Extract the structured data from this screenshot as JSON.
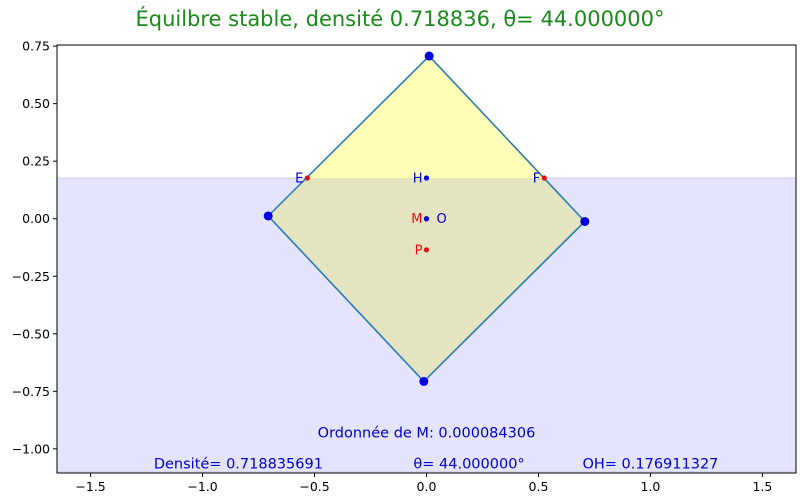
{
  "chart_data": {
    "type": "scatter",
    "title": "Équilbre stable, densité 0.718836, θ= 44.000000°",
    "xlim": [
      -1.65,
      1.65
    ],
    "ylim": [
      -1.105,
      0.755
    ],
    "x_ticks": [
      -1.5,
      -1.0,
      -0.5,
      0.0,
      0.5,
      1.0,
      1.5
    ],
    "y_ticks": [
      -1.0,
      -0.75,
      -0.5,
      -0.25,
      0.0,
      0.25,
      0.5,
      0.75
    ],
    "x_tick_labels": [
      "−1.5",
      "−1.0",
      "−0.5",
      "0.0",
      "0.5",
      "1.0",
      "1.5"
    ],
    "y_tick_labels": [
      "−1.00",
      "−0.75",
      "−0.50",
      "−0.25",
      "0.00",
      "0.25",
      "0.50",
      "0.75"
    ],
    "grid": false,
    "water": {
      "x": [
        -1.65,
        1.65
      ],
      "y_bottom": -1.1,
      "y_top": 0.177,
      "color": "#e4e4fc",
      "edge": "#cfcff5"
    },
    "square": {
      "vertices": [
        [
          0.012,
          0.707
        ],
        [
          0.707,
          -0.012
        ],
        [
          -0.012,
          -0.707
        ],
        [
          -0.707,
          0.012
        ]
      ],
      "edge_color": "#2c7bb6",
      "fill_above_color": "#ffffb8",
      "fill_below_color": "#e4e4c0"
    },
    "vertex_points": {
      "color": "#0000e0"
    },
    "labeled_points": [
      {
        "name": "E",
        "x": -0.532,
        "y": 0.177,
        "color": "#e01010",
        "label_color": "#0000cc",
        "label_side": "left"
      },
      {
        "name": "F",
        "x": 0.526,
        "y": 0.177,
        "color": "#e01010",
        "label_color": "#0000cc",
        "label_side": "left"
      },
      {
        "name": "H",
        "x": 0.0,
        "y": 0.177,
        "color": "#0000e0",
        "label_color": "#0000cc",
        "label_side": "left"
      },
      {
        "name": "M",
        "x": 0.0,
        "y": 0.0,
        "color": "#e01010",
        "label_color": "#e01010",
        "label_side": "left"
      },
      {
        "name": "O",
        "x": 0.0,
        "y": 0.0,
        "color": "#0000e0",
        "label_color": "#0000cc",
        "label_side": "right"
      },
      {
        "name": "P",
        "x": 0.0,
        "y": -0.135,
        "color": "#e01010",
        "label_color": "#e01010",
        "label_side": "left"
      }
    ],
    "annotations": [
      {
        "text": "Ordonnée de M:  0.000084306",
        "x": 0.0,
        "y": -0.93,
        "anchor": "middle"
      },
      {
        "text": "Densité= 0.718835691",
        "x": -0.84,
        "y": -1.063,
        "anchor": "middle"
      },
      {
        "text": "θ= 44.000000°",
        "x": 0.19,
        "y": -1.063,
        "anchor": "middle"
      },
      {
        "text": "OH= 0.176911327",
        "x": 1.0,
        "y": -1.063,
        "anchor": "middle"
      }
    ],
    "colors": {
      "title": "#1a8a1a",
      "annotation": "#0000cc",
      "axes": "#000000"
    }
  }
}
